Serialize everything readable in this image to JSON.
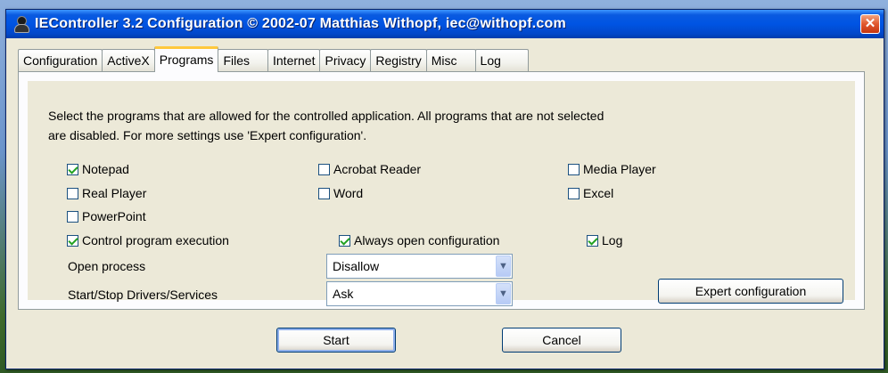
{
  "window": {
    "title": "IEController 3.2 Configuration  © 2002-07 Matthias Withopf, iec@withopf.com",
    "close_label": "✕"
  },
  "tabs": [
    {
      "label": "Configuration"
    },
    {
      "label": "ActiveX"
    },
    {
      "label": "Programs",
      "active": true
    },
    {
      "label": "Files"
    },
    {
      "label": "Internet"
    },
    {
      "label": "Privacy"
    },
    {
      "label": "Registry"
    },
    {
      "label": "Misc"
    },
    {
      "label": "Log"
    }
  ],
  "programs": {
    "description_line1": "Select the programs that are allowed for the controlled application. All programs that are not selected",
    "description_line2": "are disabled. For more settings use 'Expert configuration'.",
    "notepad": {
      "label": "Notepad",
      "checked": true
    },
    "acrobat": {
      "label": "Acrobat Reader",
      "checked": false
    },
    "media_player": {
      "label": "Media Player",
      "checked": false
    },
    "real_player": {
      "label": "Real Player",
      "checked": false
    },
    "word": {
      "label": "Word",
      "checked": false
    },
    "excel": {
      "label": "Excel",
      "checked": false
    },
    "powerpoint": {
      "label": "PowerPoint",
      "checked": false
    },
    "control_exec": {
      "label": "Control program execution",
      "checked": true
    },
    "always_open": {
      "label": "Always open configuration",
      "checked": true
    },
    "log": {
      "label": "Log",
      "checked": true
    },
    "open_process": {
      "label": "Open process",
      "value": "Disallow"
    },
    "start_stop": {
      "label": "Start/Stop Drivers/Services",
      "value": "Ask"
    },
    "expert_button": "Expert configuration"
  },
  "buttons": {
    "start": "Start",
    "cancel": "Cancel"
  }
}
